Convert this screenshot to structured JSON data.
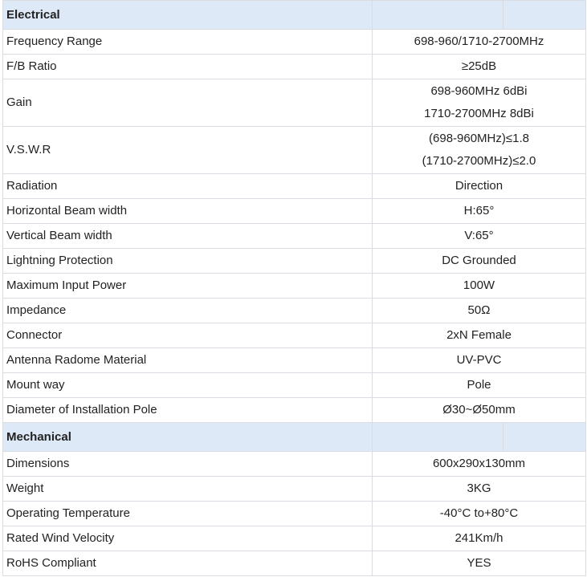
{
  "sections": [
    {
      "title": "Electrical",
      "rows": [
        {
          "label": "Frequency Range",
          "values": [
            "698-960/1710-2700MHz"
          ]
        },
        {
          "label": "F/B Ratio",
          "values": [
            "≥25dB"
          ]
        },
        {
          "label": "Gain",
          "values": [
            "698-960MHz 6dBi",
            "1710-2700MHz 8dBi"
          ]
        },
        {
          "label": "V.S.W.R",
          "values": [
            "(698-960MHz)≤1.8",
            "(1710-2700MHz)≤2.0"
          ]
        },
        {
          "label": "Radiation",
          "values": [
            "Direction"
          ]
        },
        {
          "label": "Horizontal Beam width",
          "values": [
            "H:65°"
          ]
        },
        {
          "label": "Vertical Beam width",
          "values": [
            "V:65°"
          ]
        },
        {
          "label": "Lightning Protection",
          "values": [
            "DC Grounded"
          ]
        },
        {
          "label": "Maximum Input Power",
          "values": [
            "100W"
          ]
        },
        {
          "label": "Impedance",
          "values": [
            "50Ω"
          ]
        },
        {
          "label": "Connector",
          "values": [
            "2xN  Female"
          ]
        },
        {
          "label": "Antenna Radome Material",
          "values": [
            "UV-PVC"
          ]
        },
        {
          "label": "Mount way",
          "values": [
            "Pole"
          ]
        },
        {
          "label": "Diameter of Installation Pole",
          "values": [
            "Ø30~Ø50mm"
          ]
        }
      ]
    },
    {
      "title": "Mechanical",
      "rows": [
        {
          "label": "Dimensions",
          "values": [
            "600x290x130mm"
          ]
        },
        {
          "label": "Weight",
          "values": [
            "3KG"
          ]
        },
        {
          "label": "Operating Temperature",
          "values": [
            "-40°C to+80°C"
          ]
        },
        {
          "label": "Rated Wind Velocity",
          "values": [
            "241Km/h"
          ]
        },
        {
          "label": "RoHS Compliant",
          "values": [
            "YES"
          ]
        }
      ]
    }
  ]
}
